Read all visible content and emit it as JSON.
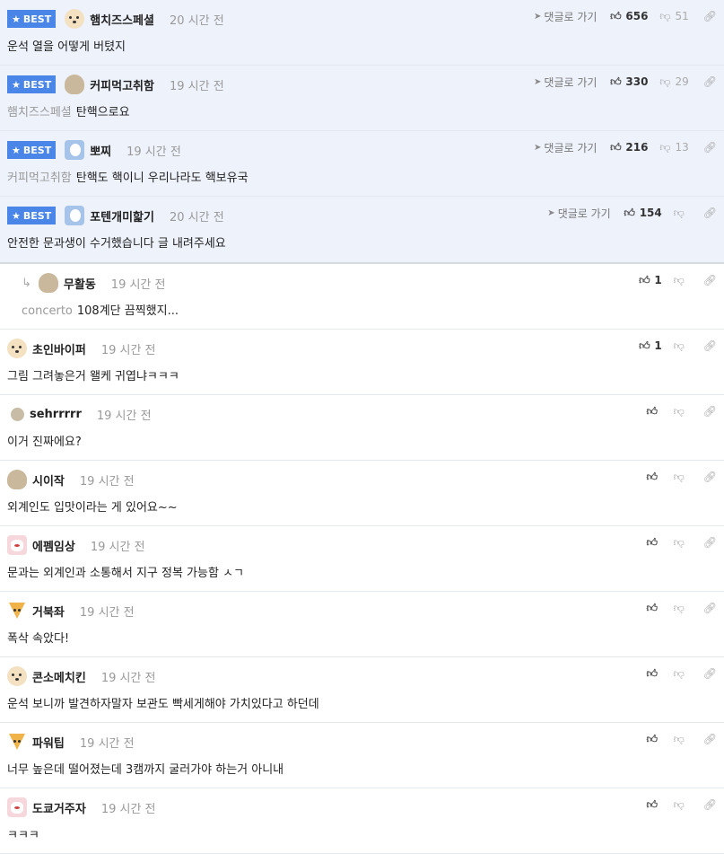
{
  "best_badge": "BEST",
  "goto_label": "댓글로 가기",
  "comments": [
    {
      "badge": true,
      "nick": "햄치즈스페셜",
      "time": "20 시간 전",
      "mention": "",
      "text": "운석 열을 어떻게 버텼지",
      "up": "656",
      "down": "51",
      "goto": true,
      "avatar": "dog-icon"
    },
    {
      "badge": true,
      "nick": "커피먹고취함",
      "time": "19 시간 전",
      "mention": "햄치즈스페셜",
      "text": "탄핵으로요",
      "up": "330",
      "down": "29",
      "goto": true,
      "avatar": "rock-icon"
    },
    {
      "badge": true,
      "nick": "뽀찌",
      "time": "19 시간 전",
      "mention": "커피먹고취함",
      "text": "탄핵도 핵이니 우리나라도 핵보유국",
      "up": "216",
      "down": "13",
      "goto": true,
      "avatar": "seal-icon"
    },
    {
      "badge": true,
      "nick": "포텐개미핥기",
      "time": "20 시간 전",
      "mention": "",
      "text": "안전한 문과생이 수거했습니다 글 내려주세요",
      "up": "154",
      "down": "",
      "goto": true,
      "avatar": "seal-icon"
    },
    {
      "badge": false,
      "reply": true,
      "nick": "무활동",
      "time": "19 시간 전",
      "mention": "concerto",
      "text": "108계단 끔찍했지...",
      "up": "1",
      "down": "",
      "goto": false,
      "avatar": "rock-icon"
    },
    {
      "badge": false,
      "nick": "초인바이퍼",
      "time": "19 시간 전",
      "mention": "",
      "text": "그림 그려놓은거 왤케 귀엽냐ㅋㅋㅋ",
      "up": "1",
      "down": "",
      "goto": false,
      "avatar": "dog-icon"
    },
    {
      "badge": false,
      "nick": "sehrrrrr",
      "time": "19 시간 전",
      "mention": "",
      "text": "이거 진짜에요?",
      "up": "",
      "down": "",
      "goto": false,
      "avatar": "dot-icon"
    },
    {
      "badge": false,
      "nick": "시이작",
      "time": "19 시간 전",
      "mention": "",
      "text": "외계인도 입맛이라는 게 있어요~~",
      "up": "",
      "down": "",
      "goto": false,
      "avatar": "rock-icon"
    },
    {
      "badge": false,
      "nick": "에펨임상",
      "time": "19 시간 전",
      "mention": "",
      "text": "문과는 외계인과 소통해서 지구 정복 가능함 ㅅㄱ",
      "up": "",
      "down": "",
      "goto": false,
      "avatar": "pet-icon"
    },
    {
      "badge": false,
      "nick": "거북좌",
      "time": "19 시간 전",
      "mention": "",
      "text": "폭삭 속았다!",
      "up": "",
      "down": "",
      "goto": false,
      "avatar": "fox-icon"
    },
    {
      "badge": false,
      "nick": "콘소메치킨",
      "time": "19 시간 전",
      "mention": "",
      "text": "운석 보니까 발견하자말자 보관도 빡세게해야 가치있다고 하던데",
      "up": "",
      "down": "",
      "goto": false,
      "avatar": "dog-icon"
    },
    {
      "badge": false,
      "nick": "파워팁",
      "time": "19 시간 전",
      "mention": "",
      "text": "너무 높은데 떨어졌는데 3캠까지 굴러가야 하는거 아니내",
      "up": "",
      "down": "",
      "goto": false,
      "avatar": "fox-icon"
    },
    {
      "badge": false,
      "nick": "도쿄거주자",
      "time": "19 시간 전",
      "mention": "",
      "text": "ㅋㅋㅋ",
      "up": "",
      "down": "",
      "goto": false,
      "avatar": "pet-icon"
    }
  ]
}
